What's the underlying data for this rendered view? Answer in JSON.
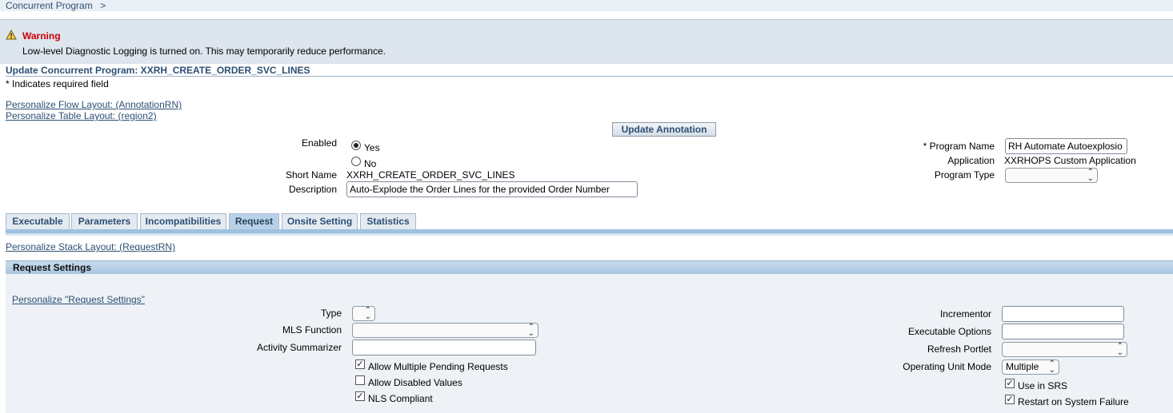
{
  "breadcrumb": {
    "item": "Concurrent Program",
    "sep": ">"
  },
  "warning": {
    "title": "Warning",
    "message": "Low-level Diagnostic Logging is turned on. This may temporarily reduce performance."
  },
  "page": {
    "title": "Update Concurrent Program: XXRH_CREATE_ORDER_SVC_LINES",
    "required_note": "*  Indicates required field"
  },
  "links": {
    "flow_layout": "Personalize Flow Layout: (AnnotationRN)",
    "table_layout": "Personalize Table Layout: (region2)",
    "stack_layout": "Personalize Stack Layout: (RequestRN)",
    "request_settings": "Personalize \"Request Settings\""
  },
  "buttons": {
    "update_annotation": "Update Annotation"
  },
  "form": {
    "enabled_label": "Enabled",
    "enabled_yes": "Yes",
    "enabled_no": "No",
    "enabled_value": "Yes",
    "short_name_label": "Short Name",
    "short_name_value": "XXRH_CREATE_ORDER_SVC_LINES",
    "description_label": "Description",
    "description_value": "Auto-Explode the Order Lines for the provided Order Number",
    "program_name_label": "* Program Name",
    "program_name_value": "RH Automate Autoexplosio",
    "application_label": "Application",
    "application_value": "XXRHOPS Custom Application",
    "program_type_label": "Program Type",
    "program_type_value": ""
  },
  "tabs": [
    {
      "label": "Executable",
      "active": false
    },
    {
      "label": "Parameters",
      "active": false
    },
    {
      "label": "Incompatibilities",
      "active": false
    },
    {
      "label": "Request",
      "active": true
    },
    {
      "label": "Onsite Setting",
      "active": false
    },
    {
      "label": "Statistics",
      "active": false
    }
  ],
  "request_settings": {
    "section_title": "Request Settings",
    "type_label": "Type",
    "type_value": "",
    "mls_function_label": "MLS Function",
    "mls_function_value": "",
    "activity_summarizer_label": "Activity Summarizer",
    "activity_summarizer_value": "",
    "allow_multiple_pending": {
      "label": "Allow Multiple Pending Requests",
      "checked": true
    },
    "allow_disabled_values": {
      "label": "Allow Disabled Values",
      "checked": false
    },
    "nls_compliant": {
      "label": "NLS Compliant",
      "checked": true
    },
    "incrementor_label": "Incrementor",
    "incrementor_value": "",
    "executable_options_label": "Executable Options",
    "executable_options_value": "",
    "refresh_portlet_label": "Refresh Portlet",
    "refresh_portlet_value": "",
    "operating_unit_mode_label": "Operating Unit Mode",
    "operating_unit_mode_value": "Multiple",
    "use_in_srs": {
      "label": "Use in SRS",
      "checked": true
    },
    "restart_on_failure": {
      "label": "Restart on System Failure",
      "checked": true
    }
  },
  "colors": {
    "link": "#2c4f74",
    "warning_title": "#cc0000",
    "warning_bg": "#dde5ee",
    "tab_active_bg": "#b9d1e8",
    "section_bar": "#a9c6e2"
  },
  "icons": {
    "warning": "warning-triangle-icon",
    "select_arrows": "updown-arrows-icon",
    "check": "checkmark-icon"
  }
}
